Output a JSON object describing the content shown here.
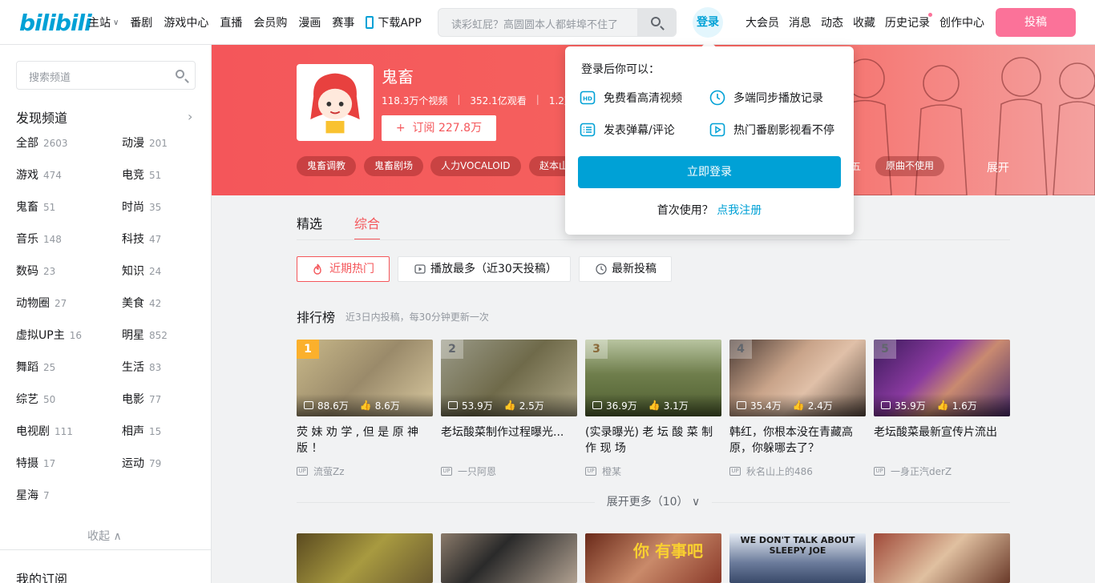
{
  "header": {
    "logo": "bilibili",
    "nav_left": [
      {
        "label": "主站",
        "dropdown": true
      },
      {
        "label": "番剧"
      },
      {
        "label": "游戏中心"
      },
      {
        "label": "直播"
      },
      {
        "label": "会员购"
      },
      {
        "label": "漫画"
      },
      {
        "label": "赛事"
      },
      {
        "label": "下载APP",
        "icon": "phone-icon"
      }
    ],
    "search_placeholder": "读彩虹屁？高圆圆本人都蚌埠不住了",
    "login_label": "登录",
    "nav_right": [
      "大会员",
      "消息",
      "动态",
      "收藏",
      "历史记录",
      "创作中心"
    ],
    "upload_label": "投稿"
  },
  "sidebar": {
    "search_placeholder": "搜索频道",
    "discover_label": "发现频道",
    "channels": [
      {
        "name": "全部",
        "count": "2603"
      },
      {
        "name": "动漫",
        "count": "201"
      },
      {
        "name": "游戏",
        "count": "474"
      },
      {
        "name": "电竞",
        "count": "51"
      },
      {
        "name": "鬼畜",
        "count": "51"
      },
      {
        "name": "时尚",
        "count": "35"
      },
      {
        "name": "音乐",
        "count": "148"
      },
      {
        "name": "科技",
        "count": "47"
      },
      {
        "name": "数码",
        "count": "23"
      },
      {
        "name": "知识",
        "count": "24"
      },
      {
        "name": "动物圈",
        "count": "27"
      },
      {
        "name": "美食",
        "count": "42"
      },
      {
        "name": "虚拟UP主",
        "count": "16"
      },
      {
        "name": "明星",
        "count": "852"
      },
      {
        "name": "舞蹈",
        "count": "25"
      },
      {
        "name": "生活",
        "count": "83"
      },
      {
        "name": "综艺",
        "count": "50"
      },
      {
        "name": "电影",
        "count": "77"
      },
      {
        "name": "电视剧",
        "count": "111"
      },
      {
        "name": "相声",
        "count": "15"
      },
      {
        "name": "特摄",
        "count": "17"
      },
      {
        "name": "运动",
        "count": "79"
      },
      {
        "name": "星海",
        "count": "7"
      }
    ],
    "collapse_label": "收起",
    "my_subscriptions": "我的订阅"
  },
  "channel": {
    "title": "鬼畜",
    "videos": "118.3万个视频",
    "views": "352.1亿观看",
    "extra": "1.2万个",
    "subscribe_label": "订阅 227.8万",
    "tags": [
      "鬼畜调教",
      "鬼畜剧场",
      "人力VOCALOID",
      "赵本山",
      "原曲不使用"
    ],
    "tag_hidden": "五",
    "expand_label": "展开"
  },
  "main": {
    "tabs": [
      {
        "label": "精选"
      },
      {
        "label": "综合",
        "active": true
      }
    ],
    "filters": [
      {
        "label": "近期热门",
        "active": true,
        "icon": "fire-icon"
      },
      {
        "label": "播放最多（近30天投稿）",
        "icon": "play-icon"
      },
      {
        "label": "最新投稿",
        "icon": "clock-icon"
      }
    ],
    "rank_title": "排行榜",
    "rank_subtitle": "近3日内投稿，每30分钟更新一次",
    "cards": [
      {
        "rank": "1",
        "plays": "88.6万",
        "likes": "8.6万",
        "title": "荧 妹 劝 学 , 但 是 原 神 版 ！",
        "up": "流萤Zz",
        "bg": "#b8a97a"
      },
      {
        "rank": "2",
        "plays": "53.9万",
        "likes": "2.5万",
        "title": "老坛酸菜制作过程曝光...",
        "up": "一只阿恩",
        "bg": "#8a8668"
      },
      {
        "rank": "3",
        "plays": "36.9万",
        "likes": "3.1万",
        "title": "(实录曝光) 老 坛 酸 菜 制 作 现 场",
        "up": "橙某",
        "bg": "#6f7e4c"
      },
      {
        "rank": "4",
        "plays": "35.4万",
        "likes": "2.4万",
        "title": "韩红，你根本没在青藏高原，你躲哪去了？",
        "up": "秋名山上的486",
        "bg": "#7a6a60"
      },
      {
        "rank": "5",
        "plays": "35.9万",
        "likes": "1.6万",
        "title": "老坛酸菜最新宣传片流出",
        "up": "一身正汽derZ",
        "bg": "#6b3e7a"
      }
    ],
    "more_label": "展开更多（10）",
    "second_row_colors": [
      "#8a7a3a",
      "#6b5a4a",
      "#7a3a2a",
      "#6a7a9a",
      "#8a4a3a"
    ],
    "second_row_texts": [
      "",
      "",
      "你 有事吧",
      "WE DON'T TALK ABOUT SLEEPY JOE",
      ""
    ]
  },
  "login_popup": {
    "heading": "登录后你可以：",
    "features": [
      {
        "label": "免费看高清视频",
        "icon": "hd-icon"
      },
      {
        "label": "多端同步播放记录",
        "icon": "clock-icon"
      },
      {
        "label": "发表弹幕/评论",
        "icon": "comment-icon"
      },
      {
        "label": "热门番剧影视看不停",
        "icon": "tv-play-icon"
      }
    ],
    "login_button": "立即登录",
    "first_use": "首次使用？",
    "register_link": "点我注册"
  },
  "colors": {
    "brand_blue": "#00a1d6",
    "brand_pink": "#fb7299",
    "channel_red": "#f4565a"
  }
}
